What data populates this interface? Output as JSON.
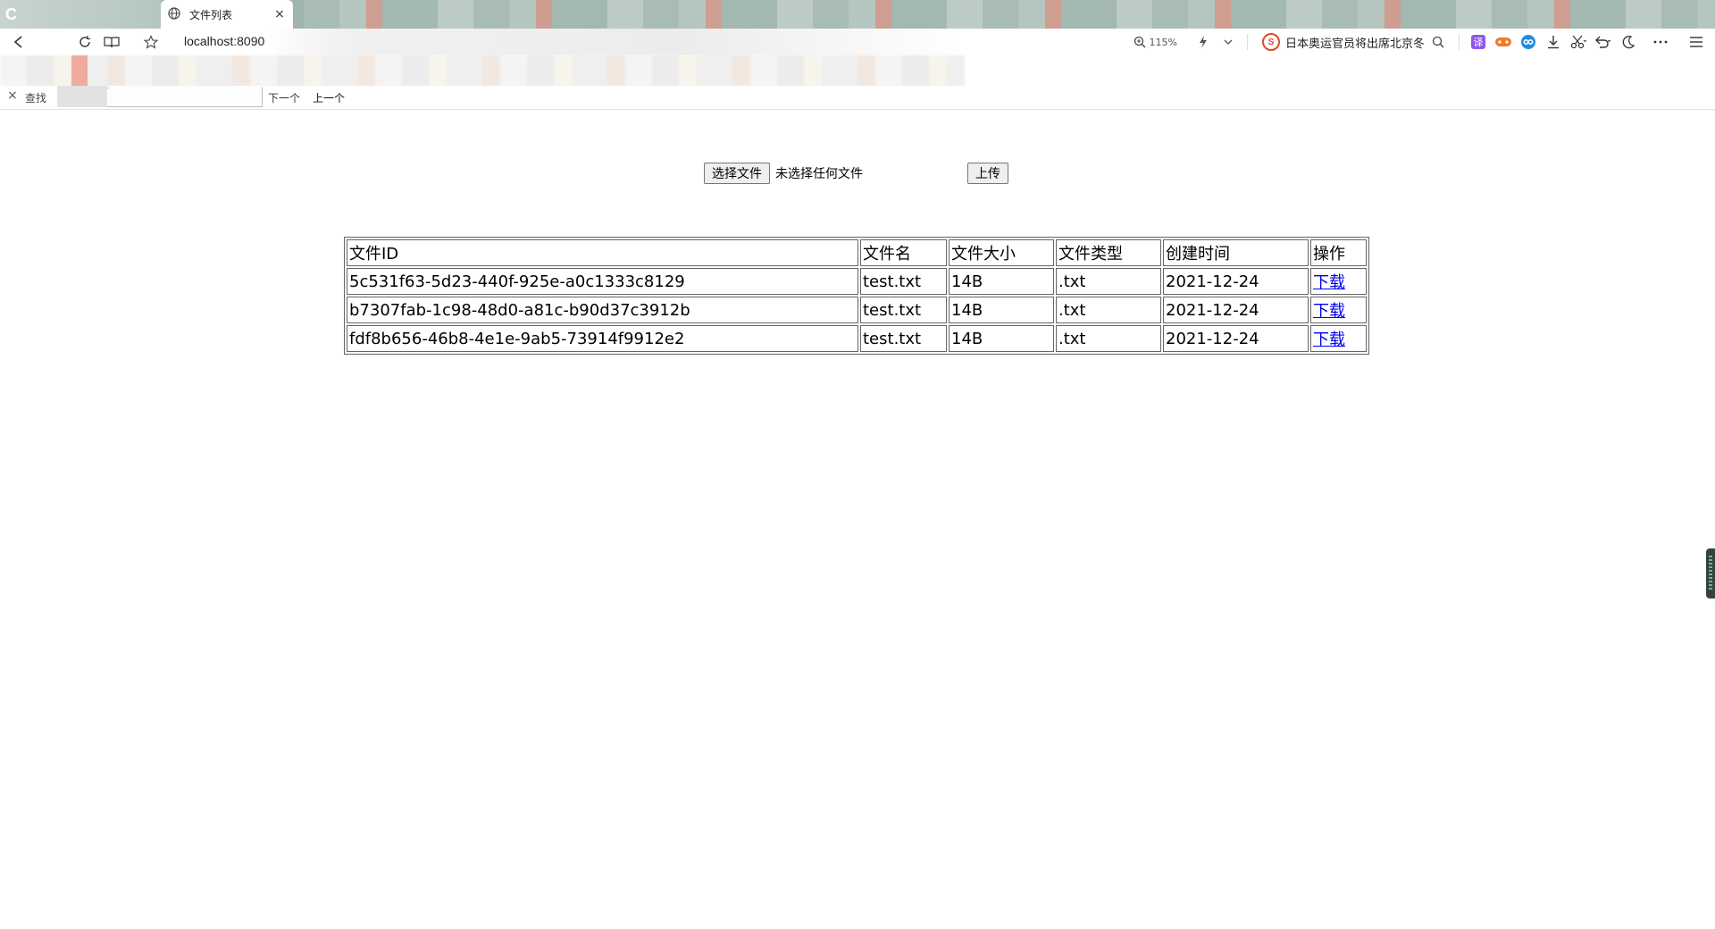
{
  "browser": {
    "tab": {
      "title": "文件列表",
      "close_glyph": "×"
    },
    "address": "localhost:8090",
    "zoom": "115%",
    "news_headline": "日本奥运官员将出席北京冬",
    "find_bar": {
      "close_glyph": "×",
      "label": "查找",
      "next_label": "下一个",
      "prev_label": "上一个"
    }
  },
  "upload": {
    "choose_button": "选择文件",
    "no_file_text": "未选择任何文件",
    "upload_button": "上传"
  },
  "table": {
    "headers": [
      "文件ID",
      "文件名",
      "文件大小",
      "文件类型",
      "创建时间",
      "操作"
    ],
    "rows": [
      {
        "id": "5c531f63-5d23-440f-925e-a0c1333c8129",
        "name": "test.txt",
        "size": "14B",
        "type": ".txt",
        "created": "2021-12-24",
        "action": "下载"
      },
      {
        "id": "b7307fab-1c98-48d0-a81c-b90d37c3912b",
        "name": "test.txt",
        "size": "14B",
        "type": ".txt",
        "created": "2021-12-24",
        "action": "下载"
      },
      {
        "id": "fdf8b656-46b8-4e1e-9ab5-73914f9912e2",
        "name": "test.txt",
        "size": "14B",
        "type": ".txt",
        "created": "2021-12-24",
        "action": "下载"
      }
    ]
  },
  "colors": {
    "link": "#0000ee",
    "tabstrip": "#9fb5ad"
  }
}
